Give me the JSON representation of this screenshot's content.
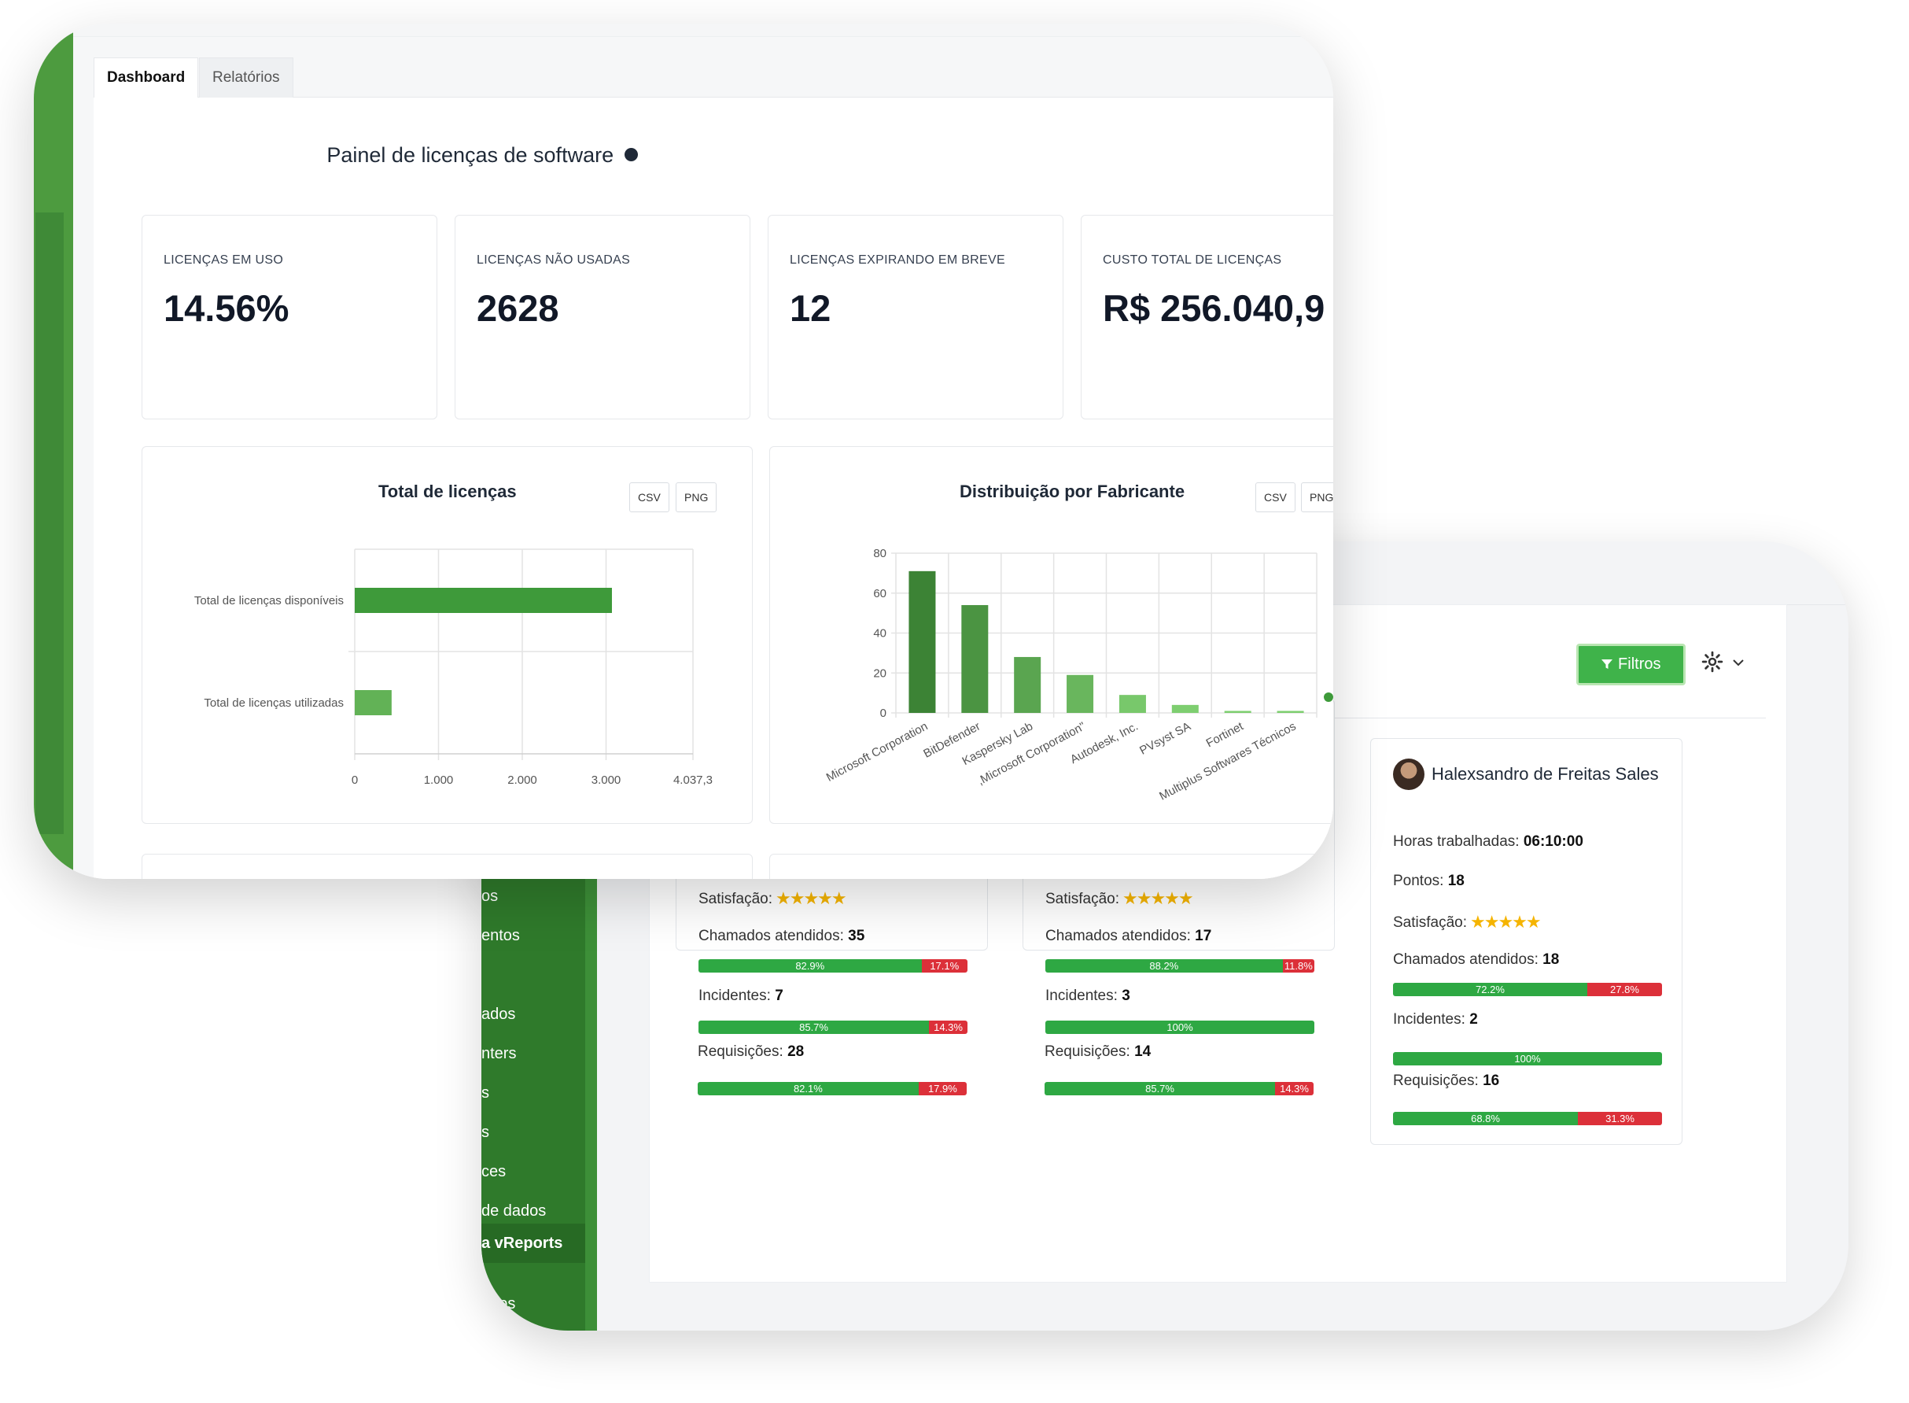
{
  "front": {
    "tabs": [
      {
        "label": "Dashboard"
      },
      {
        "label": "Relatórios"
      }
    ],
    "title": "Painel de licenças de software",
    "kpis": [
      {
        "label": "LICENÇAS EM USO",
        "value": "14.56%"
      },
      {
        "label": "LICENÇAS NÃO USADAS",
        "value": "2628"
      },
      {
        "label": "LICENÇAS EXPIRANDO EM BREVE",
        "value": "12"
      },
      {
        "label": "CUSTO TOTAL DE LICENÇAS",
        "value": "R$ 256.040,9"
      }
    ],
    "export": {
      "csv": "CSV",
      "png": "PNG"
    },
    "colors": {
      "accent": "#4b9a38",
      "bar_dark": "#3e9a3a",
      "bar_light": "#7dcf6f",
      "sidebar": "#4d9b3f"
    }
  },
  "chart_data": [
    {
      "type": "bar",
      "orientation": "horizontal",
      "title": "Total de licenças",
      "categories": [
        "Total de licenças disponíveis",
        "Total de licenças utilizadas"
      ],
      "values": [
        3070,
        440
      ],
      "xticks": [
        "0",
        "1.000",
        "2.000",
        "3.000",
        "4.037,3"
      ],
      "xlim": [
        0,
        4037.3
      ],
      "grid": true
    },
    {
      "type": "bar",
      "title": "Distribuição por Fabricante",
      "categories": [
        "Microsoft Corporation",
        "BitDefender",
        "Kaspersky Lab",
        ",Microsoft Corporation\"",
        "Autodesk, Inc.",
        "PVsyst SA",
        "Fortinet",
        "Multiplus Softwares Técnicos"
      ],
      "values": [
        71,
        54,
        28,
        19,
        9,
        4,
        1,
        1
      ],
      "yticks": [
        "0",
        "20",
        "40",
        "60",
        "80"
      ],
      "ylim": [
        0,
        80
      ],
      "grid": true
    }
  ],
  "back": {
    "sidebar_items": [
      {
        "label": "os"
      },
      {
        "label": "entos"
      },
      {
        "label": "ados"
      },
      {
        "label": "nters"
      },
      {
        "label": "s"
      },
      {
        "label": "s"
      },
      {
        "label": "ces"
      },
      {
        "label": "de dados"
      },
      {
        "label": "a vReports"
      },
      {
        "label": "e"
      },
      {
        "label": "ados"
      }
    ],
    "filter_label": "Filtros",
    "labels": {
      "horas": "Horas trabalhadas:",
      "pontos": "Pontos:",
      "satisfacao": "Satisfação:",
      "chamados": "Chamados atendidos:",
      "incidentes": "Incidentes:",
      "requisicoes": "Requisições:"
    },
    "agents": [
      {
        "chamados": "35",
        "chamados_ok": "82.9%",
        "chamados_nok": "17.1%",
        "incidentes": "7",
        "incidentes_ok": "85.7%",
        "incidentes_nok": "14.3%",
        "requisicoes": "28",
        "requisicoes_ok": "82.1%",
        "requisicoes_nok": "17.9%"
      },
      {
        "chamados": "17",
        "chamados_ok": "88.2%",
        "chamados_nok": "11.8%",
        "incidentes": "3",
        "incidentes_ok": "100%",
        "incidentes_nok": "",
        "requisicoes": "14",
        "requisicoes_ok": "85.7%",
        "requisicoes_nok": "14.3%"
      },
      {
        "name": "Halexsandro de Freitas Sales",
        "horas": "06:10:00",
        "pontos": "18",
        "chamados": "18",
        "chamados_ok": "72.2%",
        "chamados_nok": "27.8%",
        "incidentes": "2",
        "incidentes_ok": "100%",
        "incidentes_nok": "",
        "requisicoes": "16",
        "requisicoes_ok": "68.8%",
        "requisicoes_nok": "31.3%"
      }
    ],
    "satisfaction_stars": 5
  }
}
